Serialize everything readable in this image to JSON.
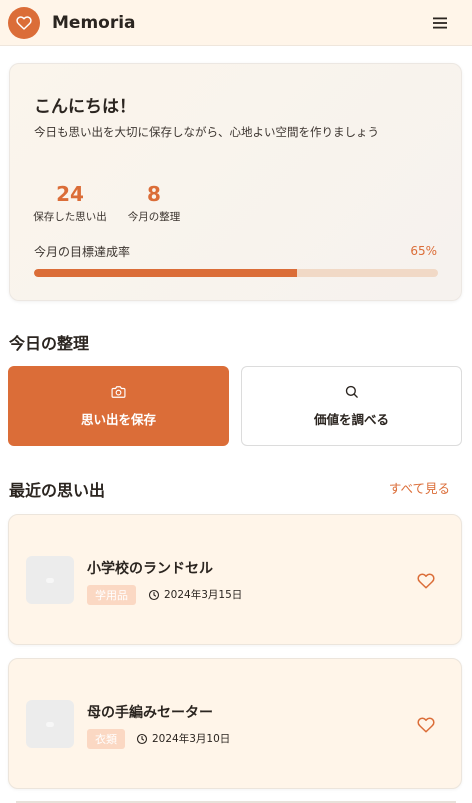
{
  "header": {
    "app_name": "Memoria"
  },
  "welcome": {
    "greeting": "こんにちは！",
    "subtitle": "今日も思い出を大切に保存しながら、心地よい空間を作りましょう",
    "stats": [
      {
        "value": "24",
        "label": "保存した思い出"
      },
      {
        "value": "8",
        "label": "今月の整理"
      }
    ],
    "goal_label": "今月の目標達成率",
    "goal_percent_text": "65%",
    "goal_fraction": 0.65
  },
  "today": {
    "title": "今日の整理",
    "actions": [
      {
        "label": "思い出を保存",
        "icon": "camera-icon"
      },
      {
        "label": "価値を調べる",
        "icon": "search-icon"
      }
    ]
  },
  "recent": {
    "title": "最近の思い出",
    "see_all": "すべて見る",
    "items": [
      {
        "title": "小学校のランドセル",
        "tag": "学用品",
        "date": "2024年3月15日"
      },
      {
        "title": "母の手編みセーター",
        "tag": "衣類",
        "date": "2024年3月10日"
      }
    ]
  },
  "colors": {
    "accent": "#db6d38",
    "header_bg": "#fff5e9",
    "card_bg": "#fff5e9",
    "tag_bg": "#fbd8c3",
    "progress_track": "#f1d9c6"
  }
}
